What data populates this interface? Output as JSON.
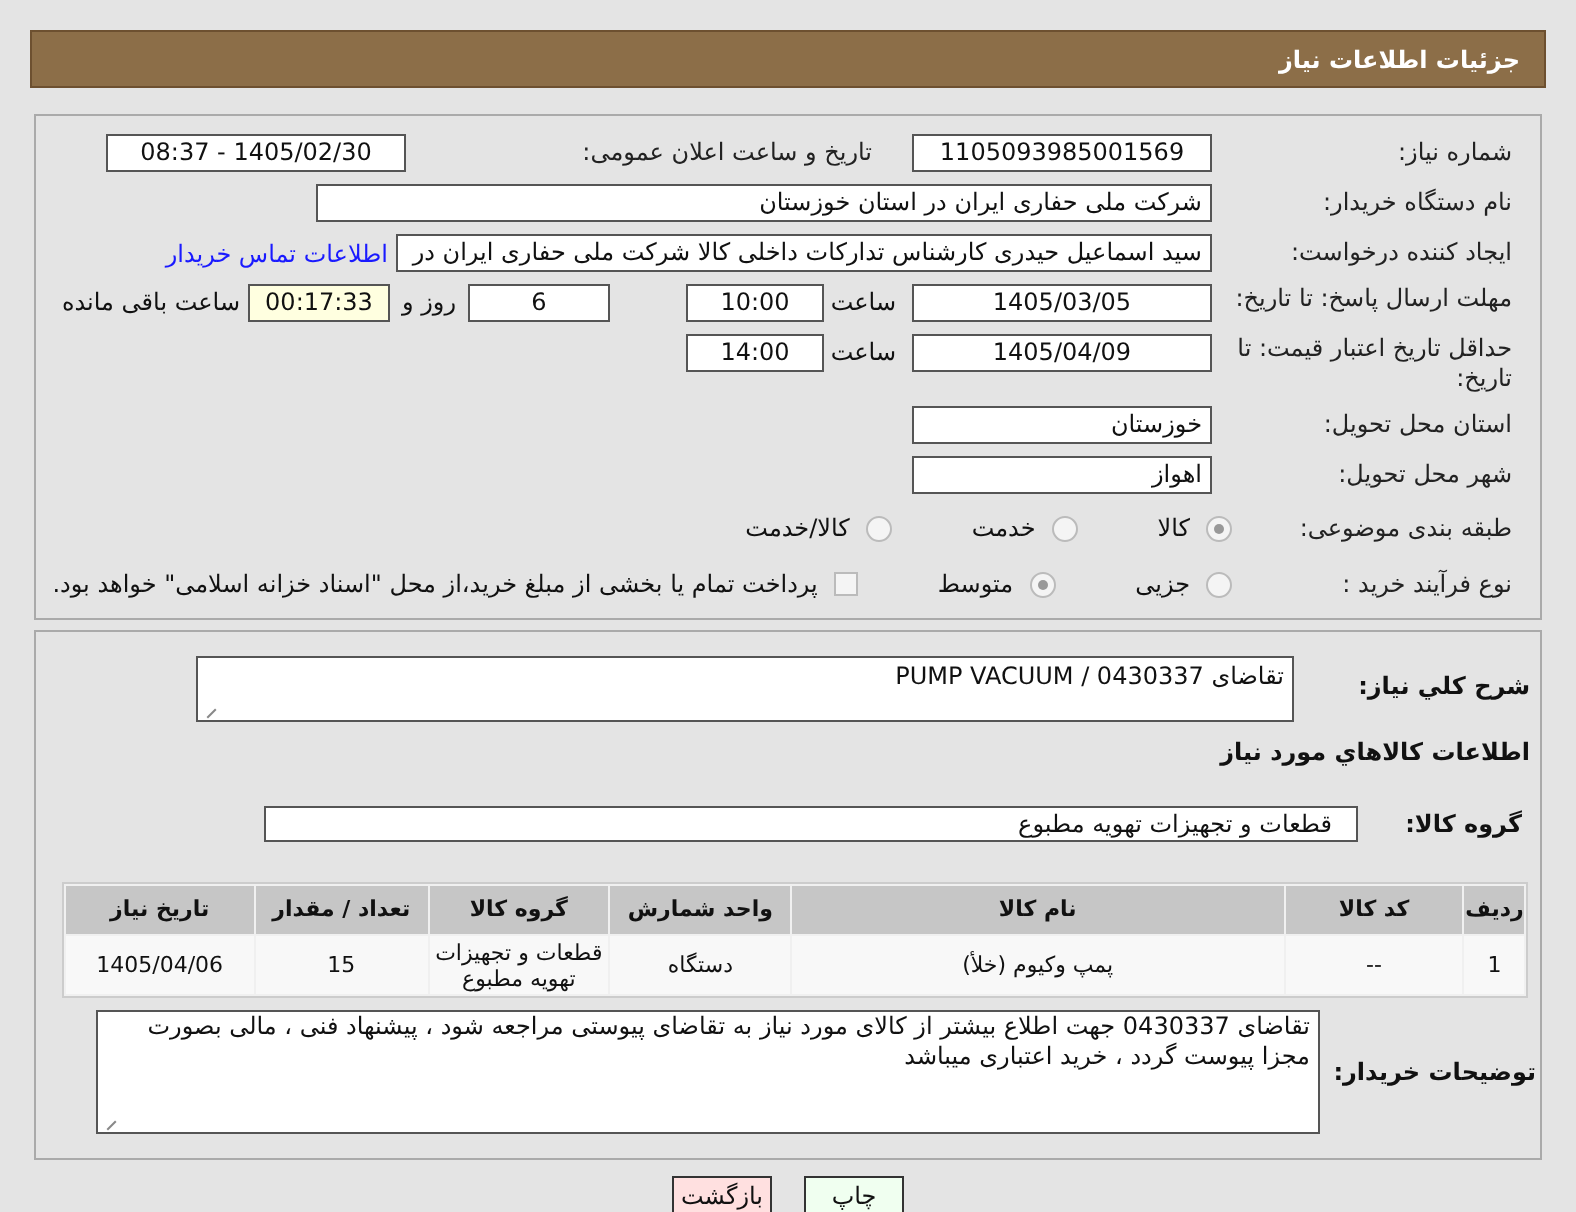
{
  "header": {
    "title": "جزئیات اطلاعات نیاز"
  },
  "need_number": {
    "label": "شماره نیاز:",
    "value": "1105093985001569"
  },
  "announce": {
    "label": "تاریخ و ساعت اعلان عمومی:",
    "value": "1405/02/30 - 08:37"
  },
  "buyer": {
    "label": "نام دستگاه خریدار:",
    "value": "شرکت ملی حفاری ایران در استان خوزستان"
  },
  "requester": {
    "label": "ایجاد کننده درخواست:",
    "value": "سید اسماعیل حیدری کارشناس تدارکات داخلی کالا شرکت ملی حفاری ایران در",
    "link": "اطلاعات تماس خریدار"
  },
  "deadline": {
    "label": "مهلت ارسال پاسخ: تا تاریخ:",
    "date": "1405/03/05",
    "time_label": "ساعت",
    "time": "10:00",
    "days": "6",
    "days_label": "روز و",
    "remaining": "00:17:33",
    "remaining_label": "ساعت باقی مانده"
  },
  "validity": {
    "label": "حداقل تاریخ اعتبار قیمت: تا تاریخ:",
    "date": "1405/04/09",
    "time_label": "ساعت",
    "time": "14:00"
  },
  "province": {
    "label": "استان محل تحویل:",
    "value": "خوزستان"
  },
  "city": {
    "label": "شهر محل تحویل:",
    "value": "اهواز"
  },
  "category": {
    "label": "طبقه بندی موضوعی:",
    "options": [
      {
        "label": "کالا",
        "selected": true
      },
      {
        "label": "خدمت",
        "selected": false
      },
      {
        "label": "کالا/خدمت",
        "selected": false
      }
    ]
  },
  "process": {
    "label": "نوع فرآیند خرید :",
    "options": [
      {
        "label": "جزیی",
        "selected": false
      },
      {
        "label": "متوسط",
        "selected": true
      }
    ],
    "checkbox": {
      "checked": false,
      "label": "پرداخت تمام یا بخشی از مبلغ خرید،از محل \"اسناد خزانه اسلامی\" خواهد بود."
    }
  },
  "description": {
    "label": "شرح کلي نياز:",
    "value": "تقاضای  PUMP VACUUM / 0430337"
  },
  "items_title": "اطلاعات کالاهاي مورد نياز",
  "group": {
    "label": "گروه کالا:",
    "value": "قطعات و تجهیزات تهویه مطبوع"
  },
  "table": {
    "columns": [
      "ردیف",
      "کد کالا",
      "نام کالا",
      "واحد شمارش",
      "گروه کالا",
      "تعداد / مقدار",
      "تاریخ نیاز"
    ],
    "rows": [
      [
        "1",
        "--",
        "پمپ وکیوم (خلأ)",
        "دستگاه",
        "قطعات و تجهیزات تهویه مطبوع",
        "15",
        "1405/04/06"
      ]
    ]
  },
  "notes": {
    "label": "توضیحات خریدار:",
    "value": "تقاضای  0430337 جهت اطلاع بیشتر از کالای مورد نیاز به تقاضای پیوستی مراجعه شود ، پیشنهاد فنی ، مالی بصورت مجزا پیوست گردد ، خرید اعتباری میباشد"
  },
  "buttons": [
    {
      "label": "چاپ",
      "kind": "print"
    },
    {
      "label": "بازگشت",
      "kind": "back"
    }
  ]
}
